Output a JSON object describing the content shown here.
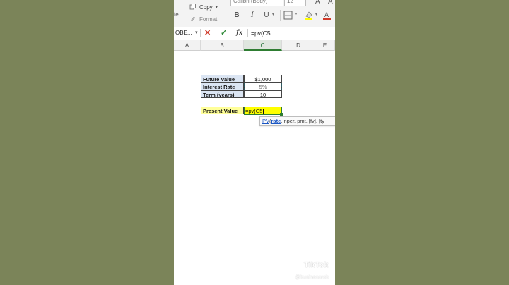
{
  "colors": {
    "background": "#7b8459",
    "label_fill": "#dbe5f3",
    "present_value_label_fill": "#ffff99",
    "active_input_fill": "#ffff00",
    "accent_green": "#2e7d32"
  },
  "ribbon": {
    "paste_fragment": "te",
    "copy_label": "Copy",
    "format_label": "Format",
    "font_name": "Calibri (Body)",
    "font_size": "12",
    "bold_label": "B",
    "italic_label": "I",
    "underline_label": "U",
    "grow_font_label": "A",
    "shrink_font_label": "A"
  },
  "formula_bar": {
    "name_box": "OBE...",
    "fx_label": "fx",
    "formula": "=pv(C5"
  },
  "columns": [
    "A",
    "B",
    "C",
    "D",
    "E"
  ],
  "active_column": "C",
  "table": {
    "rows": [
      {
        "label": "Future Value",
        "value": "$1,000"
      },
      {
        "label": "Interest Rate",
        "value": "5%"
      },
      {
        "label": "Term (years)",
        "value": "10"
      }
    ],
    "present_value_label": "Present Value",
    "present_value_input": "=pv(C5"
  },
  "tooltip": {
    "function": "PV",
    "open_paren": "(",
    "first_arg": "rate",
    "rest": ", nper, pmt, [fv], [ty"
  },
  "watermark": {
    "brand": "TikTok",
    "handle": "@businessrob"
  }
}
